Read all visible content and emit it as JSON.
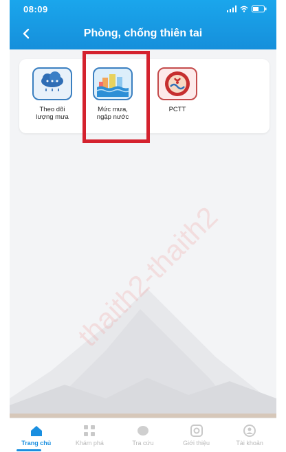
{
  "status_bar": {
    "time": "08:09"
  },
  "header": {
    "title": "Phòng, chống thiên tai"
  },
  "services": [
    {
      "label_line1": "Theo dõi",
      "label_line2": "lượng mưa",
      "icon": "rain-cloud-icon"
    },
    {
      "label_line1": "Mức mưa,",
      "label_line2": "ngập nước",
      "icon": "flooded-city-icon"
    },
    {
      "label_line1": "PCTT",
      "label_line2": "",
      "icon": "pctt-emblem-icon"
    }
  ],
  "watermark": "thaith2-thaith2",
  "tabs": [
    {
      "label": "Trang chủ",
      "icon": "home-icon",
      "active": true
    },
    {
      "label": "Khám phá",
      "icon": "grid-icon",
      "active": false
    },
    {
      "label": "Tra cứu",
      "icon": "search-icon",
      "active": false
    },
    {
      "label": "Giới thiệu",
      "icon": "info-icon",
      "active": false
    },
    {
      "label": "Tài khoản",
      "icon": "account-icon",
      "active": false
    }
  ],
  "colors": {
    "primary": "#1a8fe0",
    "highlight": "#d4222e"
  }
}
